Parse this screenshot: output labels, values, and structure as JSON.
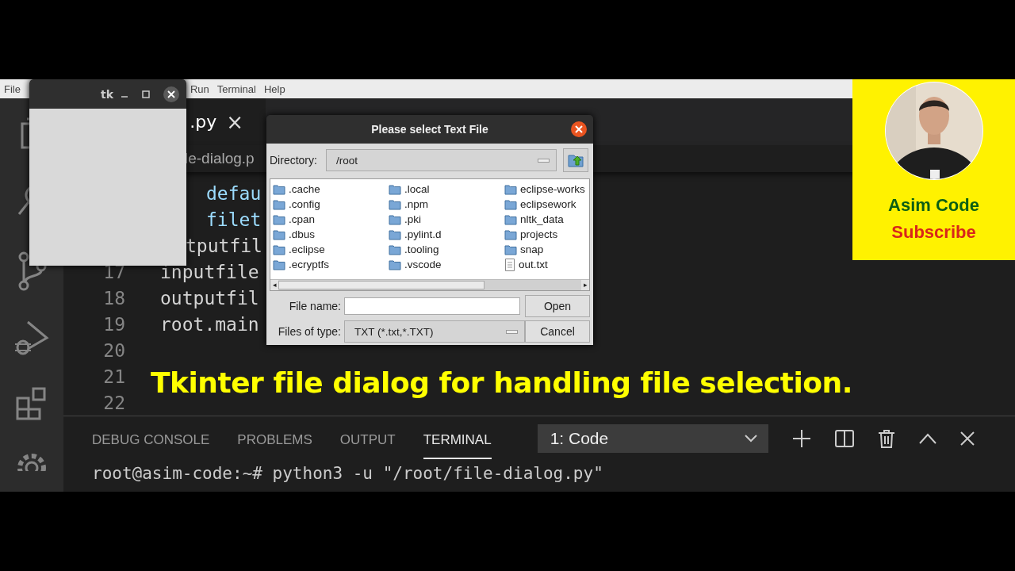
{
  "menu_bar": [
    "File",
    "Run",
    "Terminal",
    "Help"
  ],
  "editor": {
    "tab": {
      "label": ".py",
      "close": "×"
    },
    "breadcrumb": "le-dialog.p",
    "lines": [
      {
        "text": "defau",
        "kind": "param"
      },
      {
        "text": "filet",
        "kind": "param"
      },
      {
        "text": "tputfil",
        "kind": "clipped"
      },
      {
        "number": "17",
        "text": "inputfile",
        "kind": "plain"
      },
      {
        "number": "18",
        "text": "outputfil",
        "kind": "plain"
      },
      {
        "number": "19",
        "text": "root.main",
        "kind": "plain"
      },
      {
        "number": "20"
      },
      {
        "number": "21"
      },
      {
        "number": "22"
      }
    ]
  },
  "panel": {
    "tabs": [
      {
        "label": "DEBUG CONSOLE",
        "selected": false
      },
      {
        "label": "PROBLEMS",
        "selected": false
      },
      {
        "label": "OUTPUT",
        "selected": false
      },
      {
        "label": "TERMINAL",
        "selected": true
      }
    ],
    "terminal_select": "1: Code",
    "terminal_line": "root@asim-code:~# python3 -u \"/root/file-dialog.py\""
  },
  "tk_window": {
    "title": "tk"
  },
  "dialog": {
    "title": "Please select Text File",
    "directory_label": "Directory:",
    "directory": "/root",
    "files": [
      {
        "name": ".cache",
        "kind": "folder"
      },
      {
        "name": ".config",
        "kind": "folder"
      },
      {
        "name": ".cpan",
        "kind": "folder"
      },
      {
        "name": ".dbus",
        "kind": "folder"
      },
      {
        "name": ".eclipse",
        "kind": "folder"
      },
      {
        "name": ".ecryptfs",
        "kind": "folder"
      },
      {
        "name": ".local",
        "kind": "folder"
      },
      {
        "name": ".npm",
        "kind": "folder"
      },
      {
        "name": ".pki",
        "kind": "folder"
      },
      {
        "name": ".pylint.d",
        "kind": "folder"
      },
      {
        "name": ".tooling",
        "kind": "folder"
      },
      {
        "name": ".vscode",
        "kind": "folder"
      },
      {
        "name": "eclipse-works",
        "kind": "folder"
      },
      {
        "name": "eclipsework",
        "kind": "folder"
      },
      {
        "name": "nltk_data",
        "kind": "folder"
      },
      {
        "name": "projects",
        "kind": "folder"
      },
      {
        "name": "snap",
        "kind": "folder"
      },
      {
        "name": "out.txt",
        "kind": "file"
      }
    ],
    "scroll_left": "◂",
    "scroll_right": "▸",
    "file_name_label": "File name:",
    "open_button": "Open",
    "type_label": "Files of type:",
    "file_type": "TXT (*.txt,*.TXT)",
    "cancel_button": "Cancel"
  },
  "caption": "Tkinter file dialog for handling file selection.",
  "channel_card": {
    "name": "Asim Code",
    "action": "Subscribe"
  }
}
